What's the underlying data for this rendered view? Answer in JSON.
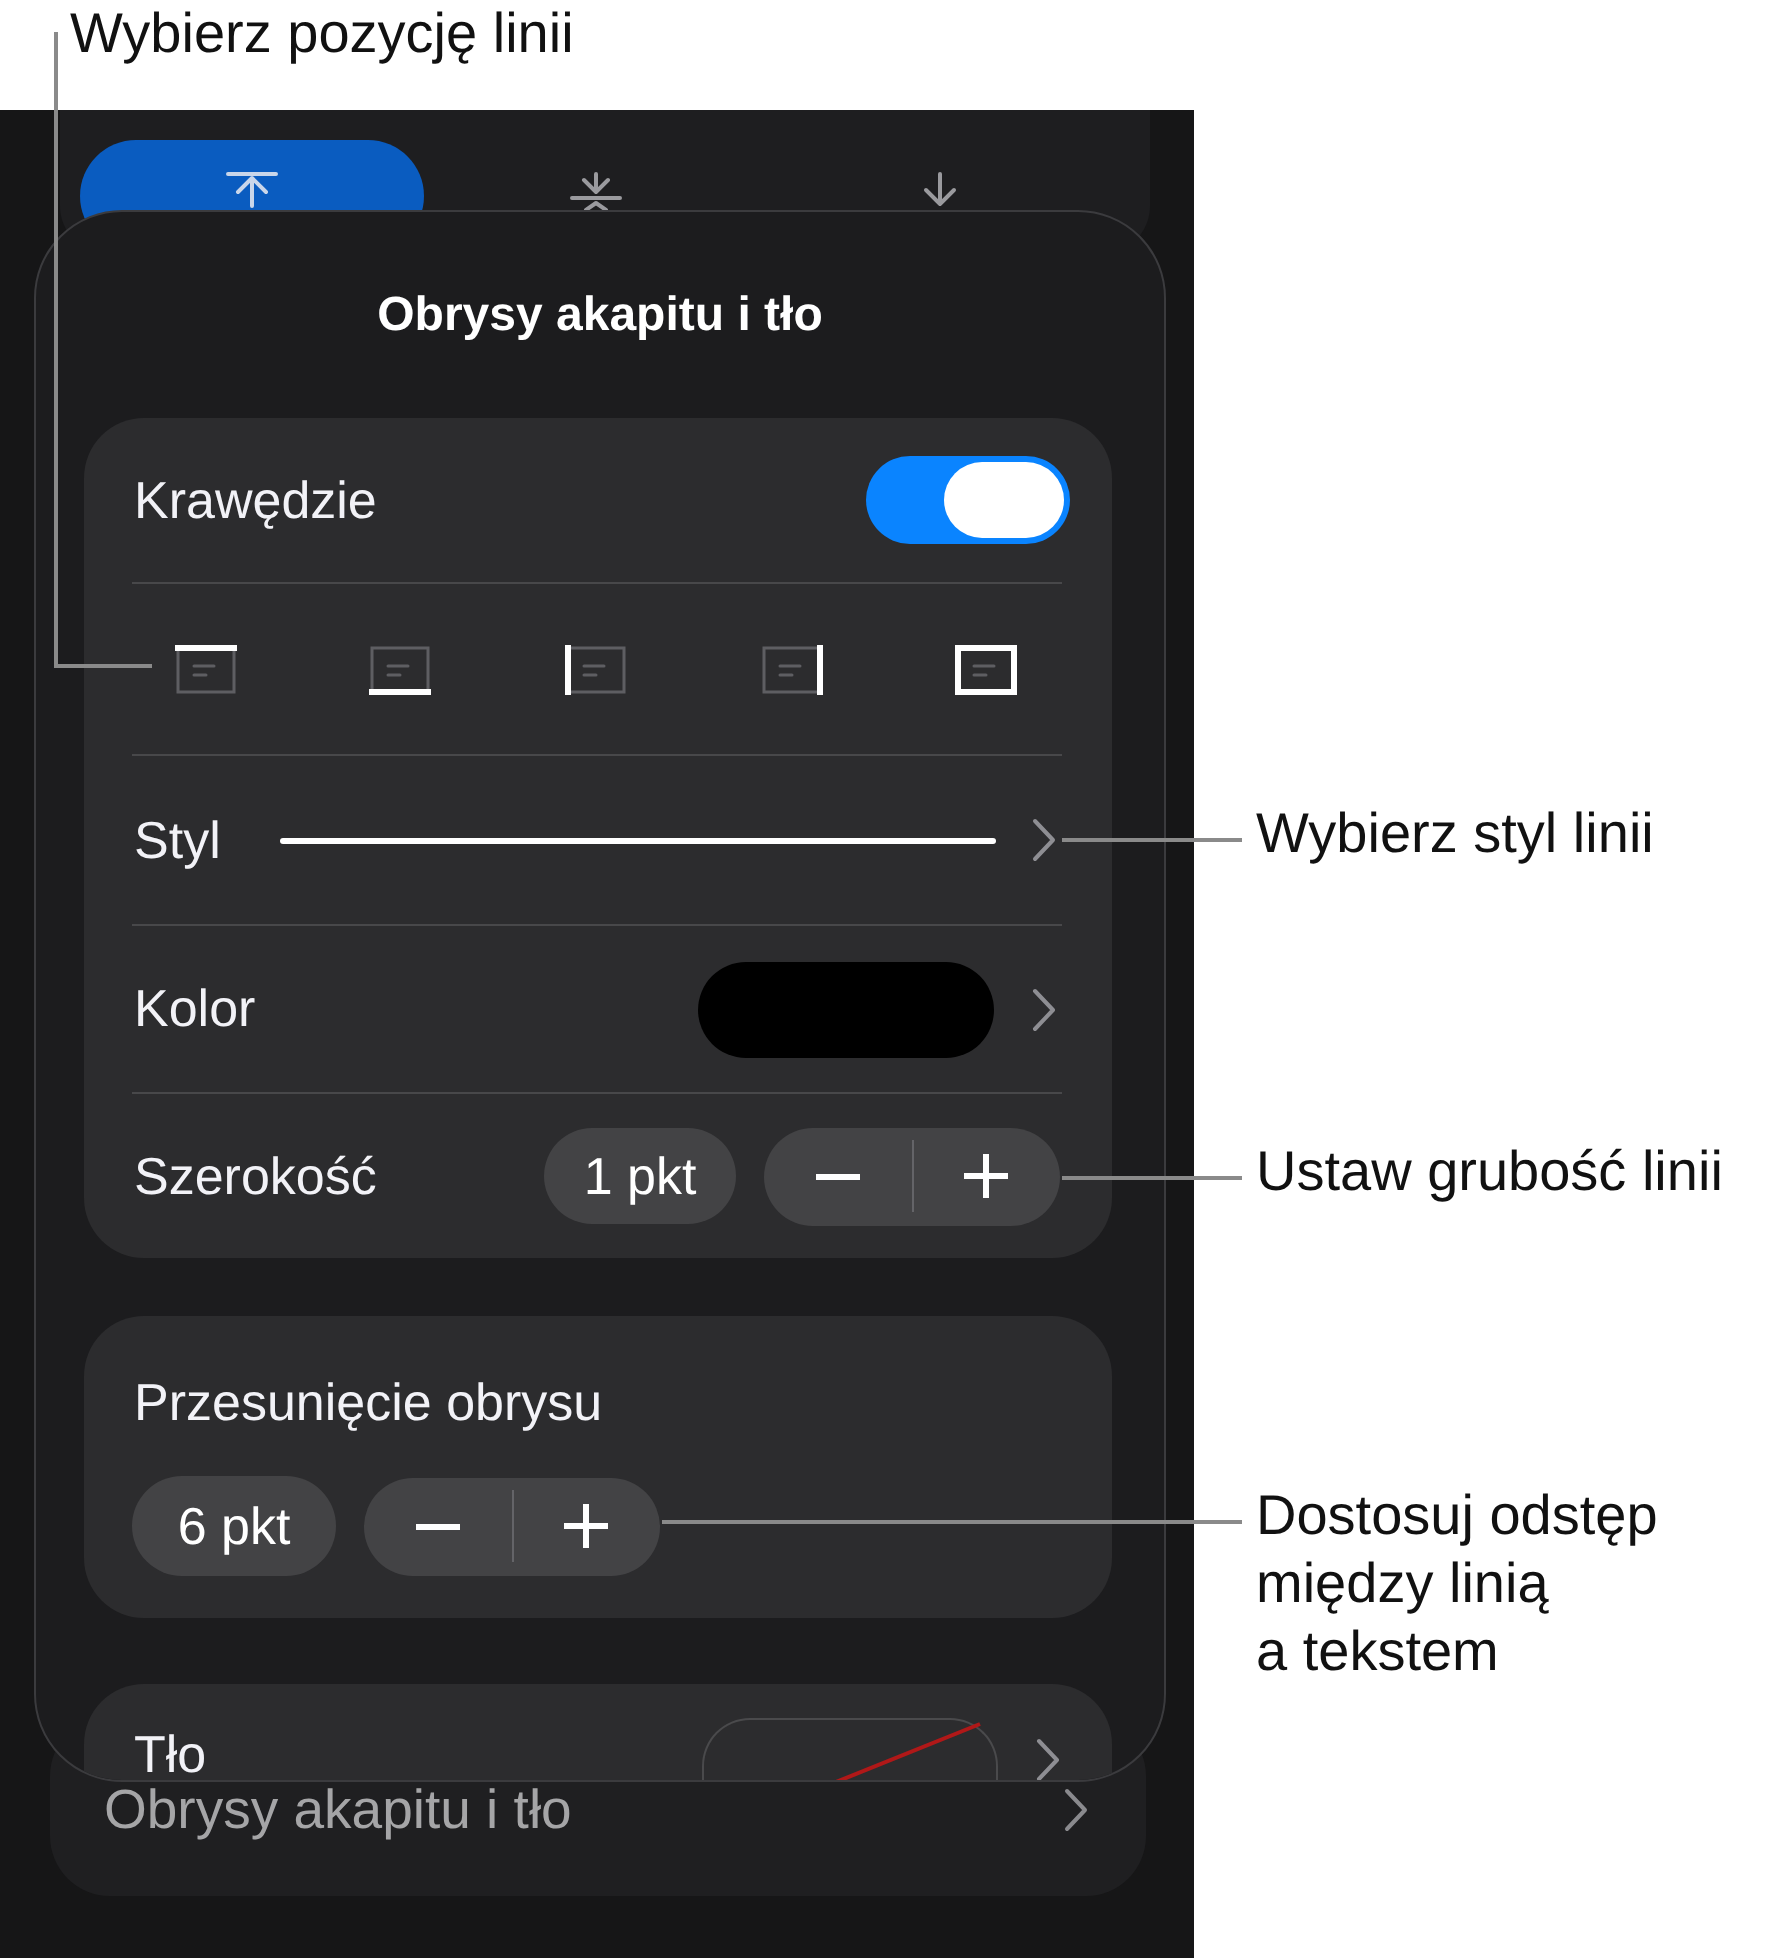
{
  "callouts": [
    {
      "text": "Wybierz pozycję linii"
    },
    {
      "text": "Wybierz styl linii"
    },
    {
      "text": "Ustaw grubość linii"
    },
    {
      "text": "Dostosuj odstęp\nmiędzy linią\na tekstem"
    }
  ],
  "position_segments": [
    {
      "kind": "top",
      "selected": true
    },
    {
      "kind": "middle",
      "selected": false
    },
    {
      "kind": "bottom",
      "selected": false
    }
  ],
  "popover": {
    "title": "Obrysy akapitu i tło",
    "borders": {
      "label": "Krawędzie",
      "on": true,
      "edge_options": [
        {
          "kind": "top"
        },
        {
          "kind": "bottom"
        },
        {
          "kind": "left"
        },
        {
          "kind": "right"
        },
        {
          "kind": "all"
        }
      ],
      "style": {
        "label": "Styl"
      },
      "color": {
        "label": "Kolor",
        "color": "#000000"
      },
      "width": {
        "label": "Szerokość",
        "value": "1 pkt"
      }
    },
    "offset": {
      "label": "Przesunięcie obrysu",
      "value": "6 pkt"
    },
    "background": {
      "label": "Tło"
    }
  },
  "menu_row": {
    "label": "Obrysy akapitu i tło"
  }
}
